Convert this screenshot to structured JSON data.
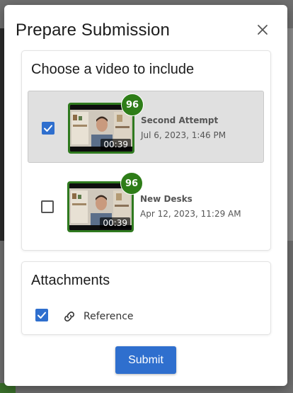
{
  "dialog": {
    "title": "Prepare Submission",
    "close_icon": "close-icon"
  },
  "videos_section": {
    "title": "Choose a video to include",
    "items": [
      {
        "name": "Second Attempt",
        "date": "Jul 6, 2023, 1:46 PM",
        "duration": "00:39",
        "score": "96",
        "selected": true
      },
      {
        "name": "New Desks",
        "date": "Apr 12, 2023, 11:29 AM",
        "duration": "00:39",
        "score": "96",
        "selected": false
      }
    ]
  },
  "attachments_section": {
    "title": "Attachments",
    "items": [
      {
        "label": "Reference",
        "icon": "link-icon",
        "checked": true
      }
    ]
  },
  "actions": {
    "submit_label": "Submit"
  },
  "colors": {
    "primary": "#2f6fce",
    "score_badge": "#2e7d18",
    "thumb_border": "#2f7a1f"
  }
}
